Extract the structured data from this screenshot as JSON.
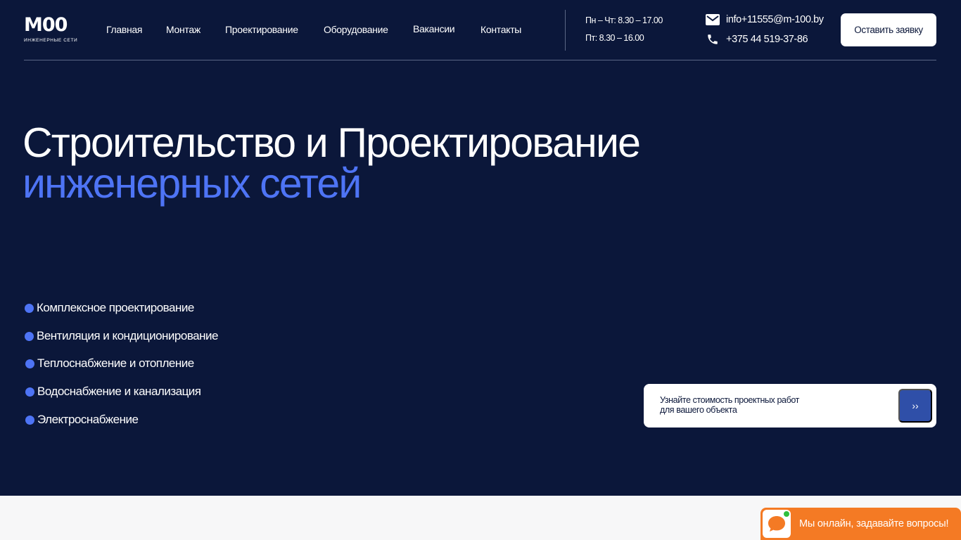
{
  "brand": {
    "logo_mark": "M00",
    "logo_sub": "ИНЖЕНЕРНЫЕ СЕТИ"
  },
  "nav": {
    "items": [
      {
        "label": "Главная"
      },
      {
        "label": "Монтаж"
      },
      {
        "label": "Проектирование"
      },
      {
        "label": "Оборудование"
      },
      {
        "label": "Вакансии"
      },
      {
        "label": "Контакты"
      }
    ]
  },
  "hours": {
    "weekdays": "Пн – Чт: 8.30 – 17.00",
    "friday": "Пт: 8.30 – 16.00"
  },
  "contacts": {
    "email": "info+11555@m-100.by",
    "phone": "+375 44 519-37-86",
    "email_icon": "mail-icon",
    "phone_icon": "phone-icon"
  },
  "header": {
    "cta_label": "Оставить заявку"
  },
  "hero": {
    "title_line1": "Строительство и Проектирование",
    "title_line2": "инженерных сетей"
  },
  "services": [
    {
      "label": "Комплексное проектирование"
    },
    {
      "label": "Вентиляция и кондиционирование"
    },
    {
      "label": "Теплоснабжение и отопление"
    },
    {
      "label": "Водоснабжение и канализация"
    },
    {
      "label": "Электроснабжение"
    }
  ],
  "price_card": {
    "line1": "Узнайте стоимость проектных работ",
    "line2": "для вашего объекта",
    "button_label": "››"
  },
  "chat": {
    "text": "Мы онлайн, задавайте вопросы!",
    "icon": "chat-bubble-icon"
  },
  "colors": {
    "hero_bg": "#0b173a",
    "accent_blue": "#4e74f5",
    "button_blue": "#2f4fa8",
    "chat_orange": "#f47a24",
    "online_green": "#2fbf3d"
  }
}
